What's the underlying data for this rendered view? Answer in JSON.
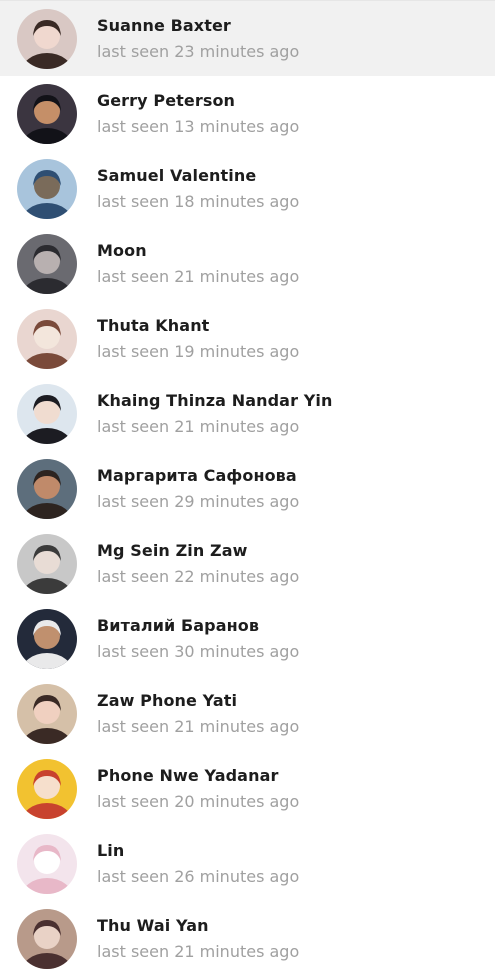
{
  "contacts": [
    {
      "name": "Suanne Baxter",
      "status": "last seen 23 minutes ago",
      "avatar": "woman-portrait-avatar",
      "selected": true,
      "colors": [
        "#d9c8c4",
        "#3a2a25",
        "#f0d8cf"
      ]
    },
    {
      "name": "Gerry Peterson",
      "status": "last seen 13 minutes ago",
      "avatar": "man-cap-avatar",
      "selected": false,
      "colors": [
        "#3b3540",
        "#121218",
        "#c58f68"
      ]
    },
    {
      "name": "Samuel Valentine",
      "status": "last seen 18 minutes ago",
      "avatar": "city-skyline-avatar",
      "selected": false,
      "colors": [
        "#a8c4dc",
        "#2f4f73",
        "#7a6b5a"
      ]
    },
    {
      "name": "Moon",
      "status": "last seen 21 minutes ago",
      "avatar": "dark-anime-avatar",
      "selected": false,
      "colors": [
        "#6a6a70",
        "#2b2b30",
        "#b8b0b0"
      ]
    },
    {
      "name": "Thuta Khant",
      "status": "last seen 19 minutes ago",
      "avatar": "anime-couple-avatar",
      "selected": false,
      "colors": [
        "#e9d6d0",
        "#7a4a3a",
        "#f3e6dc"
      ]
    },
    {
      "name": "Khaing Thinza Nandar Yin",
      "status": "last seen 21 minutes ago",
      "avatar": "anime-boy-avatar",
      "selected": false,
      "colors": [
        "#dde6ee",
        "#1c1c22",
        "#f0dcd0"
      ]
    },
    {
      "name": "Маргарита Сафонова",
      "status": "last seen 29 minutes ago",
      "avatar": "woman-outdoor-avatar",
      "selected": false,
      "colors": [
        "#5d6e7c",
        "#2d2420",
        "#c08a6a"
      ]
    },
    {
      "name": "Mg Sein Zin Zaw",
      "status": "last seen 22 minutes ago",
      "avatar": "anime-girl-avatar",
      "selected": false,
      "colors": [
        "#c8c8c8",
        "#3b3b3b",
        "#e8dcd5"
      ]
    },
    {
      "name": "Виталий Баранов",
      "status": "last seen 30 minutes ago",
      "avatar": "man-winter-hat-avatar",
      "selected": false,
      "colors": [
        "#232a3a",
        "#e9e9ea",
        "#c0906e"
      ]
    },
    {
      "name": "Zaw Phone Yati",
      "status": "last seen 21 minutes ago",
      "avatar": "anime-characters-avatar",
      "selected": false,
      "colors": [
        "#d5c0a8",
        "#3a2a25",
        "#f0d0c0"
      ]
    },
    {
      "name": "Phone Nwe Yadanar",
      "status": "last seen 20 minutes ago",
      "avatar": "anime-red-hair-avatar",
      "selected": false,
      "colors": [
        "#f2c230",
        "#c8422e",
        "#f6dfcc"
      ]
    },
    {
      "name": "Lin",
      "status": "last seen 26 minutes ago",
      "avatar": "anime-white-hair-avatar",
      "selected": false,
      "colors": [
        "#f3e4ec",
        "#e8b8c8",
        "#ffffff"
      ]
    },
    {
      "name": "Thu Wai Yan",
      "status": "last seen 21 minutes ago",
      "avatar": "anime-brown-hair-avatar",
      "selected": false,
      "colors": [
        "#b89a8a",
        "#4a3030",
        "#e9d2c6"
      ]
    }
  ]
}
